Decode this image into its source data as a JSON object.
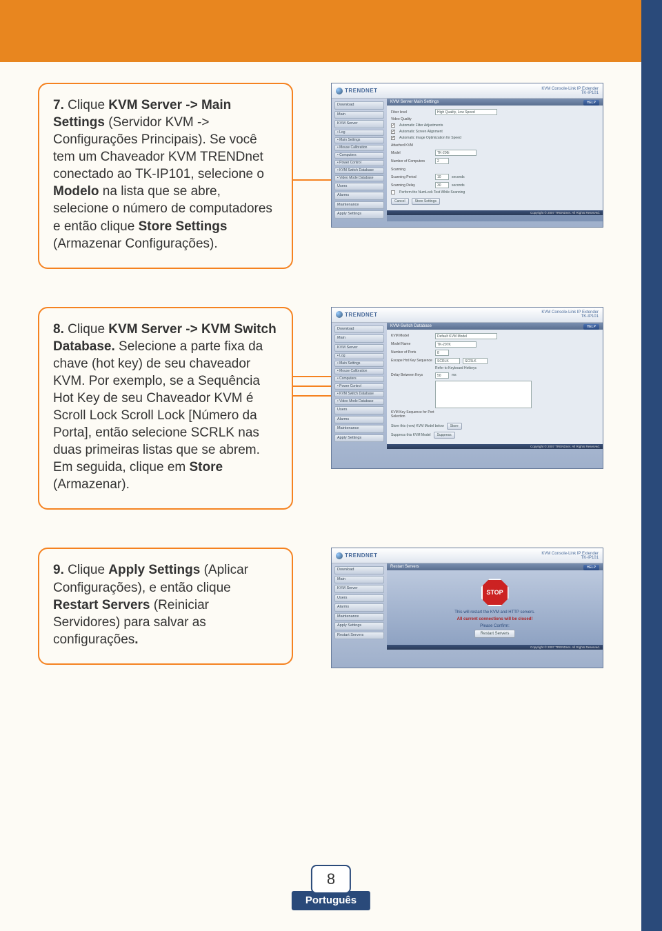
{
  "page": {
    "number": "8",
    "lang": "Português"
  },
  "steps": [
    {
      "num": "7.",
      "parts": [
        "Clique ",
        "KVM Server -> Main Settings",
        " (Servidor KVM -> Configurações Principais). Se você tem um Chaveador KVM TRENDnet conectado ao TK-IP101, selecione o ",
        "Modelo",
        " na lista que se abre, selecione o número de computadores e então clique ",
        "Store Settings",
        " (Armazenar Configurações)."
      ]
    },
    {
      "num": "8.",
      "parts": [
        "Clique ",
        "KVM Server -> KVM Switch Database.",
        " Selecione a parte fixa da chave (hot key) de seu chaveador KVM. Por exemplo, se a Sequência Hot Key de seu Chaveador KVM é Scroll Lock Scroll Lock [Número da Porta], então selecione SCRLK nas duas primeiras listas que se abrem. Em seguida, clique em ",
        "Store",
        " (Armazenar)."
      ]
    },
    {
      "num": "9.",
      "parts": [
        "Clique ",
        "Apply Settings",
        " (Aplicar Configurações), e então clique ",
        "Restart Servers",
        " (Reiniciar Servidores) para salvar as configurações",
        "."
      ]
    }
  ],
  "thumbs": {
    "brand": "TRENDNET",
    "product": "KVM Console-Link IP Extender",
    "product_sub": "TK-IP101",
    "help": "HELP",
    "footer_copy": "Copyright © 2007 TRENDnet. All Rights Reserved.",
    "sidebar_main": [
      "Download",
      "Main",
      "KVM Server",
      "Users",
      "Alarms",
      "Maintenance",
      "Apply Settings"
    ],
    "sidebar_sub": [
      "• Log",
      "• Main Settings",
      "• Mouse Calibration",
      "• Computers",
      "• Power Control",
      "• KVM Switch Database",
      "• Video Mode Database"
    ],
    "sidebar_s3": [
      "Download",
      "Main",
      "KVM Server",
      "Users",
      "Alarms",
      "Maintenance",
      "Apply Settings",
      "Restart Servers"
    ],
    "s1": {
      "title": "KVM Server Main Settings",
      "rows": {
        "video_quality": "Video Quality",
        "fiber_label": "Fiber level",
        "fiber_value": "High Quality, Low Speed",
        "auto_filter": "Automatic Filter Adjustments",
        "auto_screen": "Automatic Screen Alignment",
        "auto_image": "Automatic Image Optimization for Speed",
        "attached": "Attached KVM",
        "model_label": "Model",
        "model_value": "TK-206i",
        "num_comp_label": "Number of Computers",
        "num_comp_value": "2",
        "scanning": "Scanning",
        "scan_period_label": "Scanning Period",
        "scan_period_value": "10",
        "scan_period_unit": "seconds",
        "scan_delay_label": "Scanning Delay",
        "scan_delay_value": "30",
        "scan_delay_unit": "seconds",
        "numlock": "Perform the NumLock Test While Scanning",
        "cancel": "Cancel",
        "store": "Store Settings"
      }
    },
    "s2": {
      "title": "KVM-Switch Database",
      "kvm_model_label": "KVM Model",
      "kvm_model_value": "Default KVM Model",
      "model_name_label": "Model Name",
      "model_name_value": "TK-207K",
      "ports_label": "Number of Ports",
      "ports_value": "8",
      "escape_label": "Escape Hot Key Sequence",
      "escape_a": "SCRLK",
      "escape_b": "SCRLK",
      "refer_suffix": "Refer to Keyboard Hotkeys",
      "delay_label": "Delay Between Keys",
      "delay_value": "50",
      "delay_unit": "ms",
      "kvm_key_seq": "KVM Key Sequence for Port Selection",
      "store_model_label": "Store this (new) KVM Model below",
      "store": "Store",
      "suppress_label": "Suppress this KVM Model",
      "suppress": "Suppress"
    },
    "s3": {
      "title": "Restart Servers",
      "stop": "STOP",
      "line1": "This will restart the KVM and HTTP servers.",
      "line2": "All current connections will be closed!",
      "confirm": "Please Confirm:",
      "btn": "Restart Servers"
    }
  }
}
